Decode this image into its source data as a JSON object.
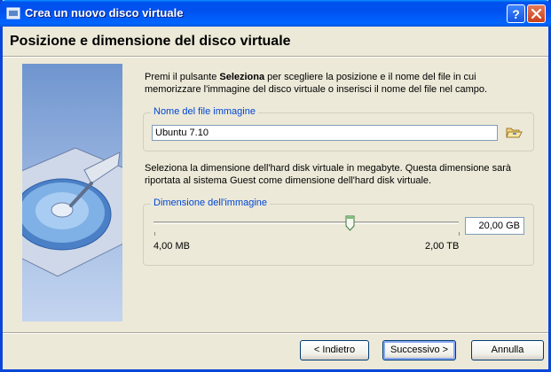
{
  "window": {
    "title": "Crea un nuovo disco virtuale"
  },
  "titlebar_buttons": {
    "help_icon": "question-mark",
    "close_icon": "x-mark"
  },
  "header": {
    "title": "Posizione e dimensione del disco virtuale"
  },
  "instructions": {
    "prefix": "Premi il pulsante ",
    "bold": "Seleziona",
    "suffix": " per scegliere la posizione e il nome del file in cui memorizzare l'immagine del disco virtuale o inserisci il nome del file nel campo."
  },
  "file_group": {
    "label": "Nome del file immagine",
    "value": "Ubuntu 7.10",
    "browse_icon": "folder-open-icon"
  },
  "size_description": "Seleziona la dimensione dell'hard disk virtuale in megabyte. Questa dimensione sarà riportata al sistema Guest come dimensione dell'hard disk virtuale.",
  "size_group": {
    "label": "Dimensione dell'immagine",
    "min_label": "4,00 MB",
    "max_label": "2,00 TB",
    "value": "20,00 GB",
    "slider_position": 0.64
  },
  "buttons": {
    "back": "< Indietro",
    "next": "Successivo >",
    "cancel": "Annulla"
  }
}
